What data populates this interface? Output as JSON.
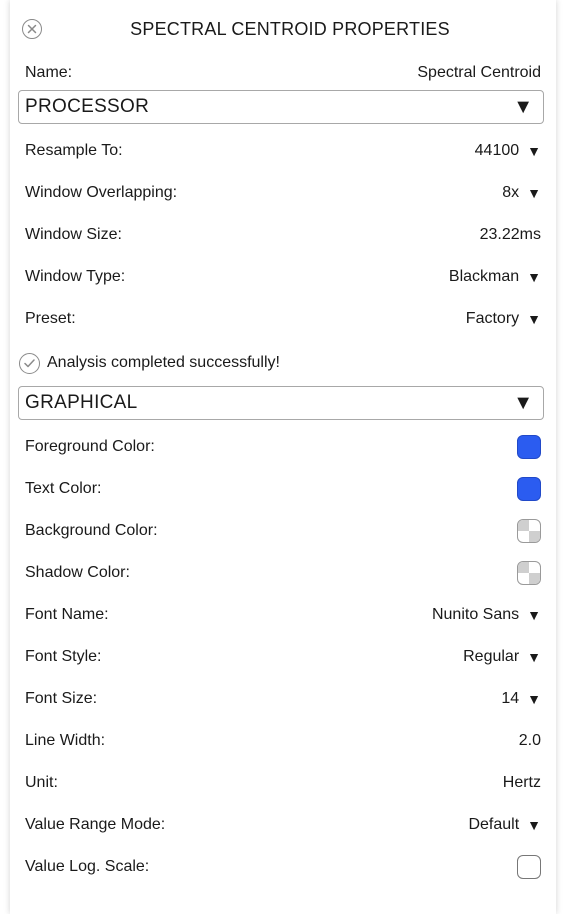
{
  "title": "SPECTRAL CENTROID PROPERTIES",
  "name_row": {
    "label": "Name:",
    "value": "Spectral Centroid"
  },
  "processor": {
    "header": "PROCESSOR",
    "rows": [
      {
        "label": "Resample To:",
        "value": "44100",
        "dropdown": true
      },
      {
        "label": "Window Overlapping:",
        "value": "8x",
        "dropdown": true
      },
      {
        "label": "Window Size:",
        "value": "23.22ms",
        "dropdown": false
      },
      {
        "label": "Window Type:",
        "value": "Blackman",
        "dropdown": true
      },
      {
        "label": "Preset:",
        "value": "Factory",
        "dropdown": true
      }
    ]
  },
  "status": {
    "text": "Analysis completed successfully!"
  },
  "graphical": {
    "header": "GRAPHICAL",
    "colors": {
      "foreground": {
        "label": "Foreground Color:",
        "color": "#2b5cf0"
      },
      "text": {
        "label": "Text Color:",
        "color": "#2b5cf0"
      },
      "background": {
        "label": "Background Color:",
        "color": "transparent"
      },
      "shadow": {
        "label": "Shadow Color:",
        "color": "transparent"
      }
    },
    "font_name": {
      "label": "Font Name:",
      "value": "Nunito Sans"
    },
    "font_style": {
      "label": "Font Style:",
      "value": "Regular"
    },
    "font_size": {
      "label": "Font Size:",
      "value": "14"
    },
    "line_width": {
      "label": "Line Width:",
      "value": "2.0"
    },
    "unit": {
      "label": "Unit:",
      "value": "Hertz"
    },
    "value_range_mode": {
      "label": "Value Range Mode:",
      "value": "Default"
    },
    "value_log_scale": {
      "label": "Value Log. Scale:",
      "checked": false
    }
  },
  "icons": {
    "dropdown": "▼",
    "close": "close-circle-icon",
    "check": "check-circle-icon"
  }
}
